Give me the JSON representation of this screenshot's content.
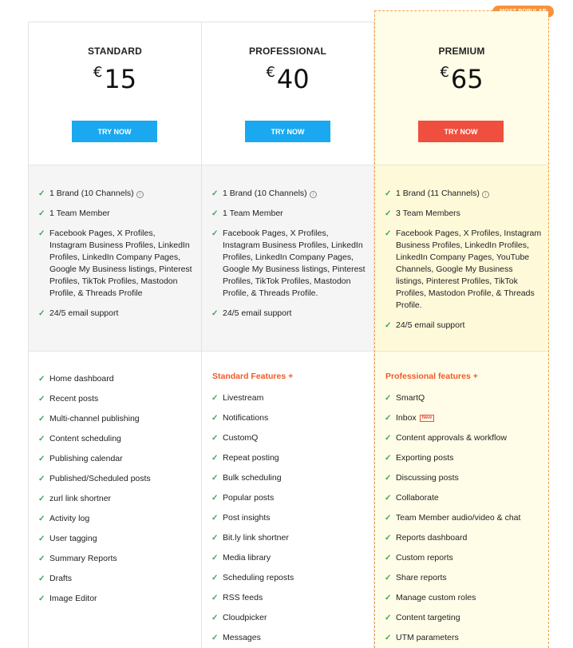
{
  "plans": [
    {
      "name": "STANDARD",
      "currency": "€",
      "price": "15",
      "cta": "TRY NOW",
      "summary": [
        {
          "text": "1 Brand (10 Channels)",
          "info": true
        },
        {
          "text": "1 Team Member"
        },
        {
          "text": "Facebook Pages, X Profiles, Instagram Business Profiles, LinkedIn Profiles, LinkedIn Company Pages, Google My Business listings, Pinterest Profiles, TikTok Profiles, Mastodon Profile, & Threads Profile"
        },
        {
          "text": "24/5 email support"
        }
      ],
      "features_heading": "",
      "features": [
        "Home dashboard",
        "Recent posts",
        "Multi-channel publishing",
        "Content scheduling",
        "Publishing calendar",
        "Published/Scheduled posts",
        "zurl link shortner",
        "Activity log",
        "User tagging",
        "Summary Reports",
        "Drafts",
        "Image Editor"
      ]
    },
    {
      "name": "PROFESSIONAL",
      "currency": "€",
      "price": "40",
      "cta": "TRY NOW",
      "summary": [
        {
          "text": "1 Brand (10 Channels)",
          "info": true
        },
        {
          "text": "1 Team Member"
        },
        {
          "text": "Facebook Pages, X Profiles, Instagram Business Profiles, LinkedIn Profiles, LinkedIn Company Pages, Google My Business listings, Pinterest Profiles, TikTok Profiles, Mastodon Profile, & Threads Profile."
        },
        {
          "text": "24/5 email support"
        }
      ],
      "features_heading": "Standard Features +",
      "features": [
        "Livestream",
        "Notifications",
        "CustomQ",
        "Repeat posting",
        "Bulk scheduling",
        "Popular posts",
        "Post insights",
        "Bit.ly link shortner",
        "Media library",
        "Scheduling reposts",
        "RSS feeds",
        "Cloudpicker",
        "Messages"
      ]
    },
    {
      "name": "PREMIUM",
      "currency": "€",
      "price": "65",
      "cta": "TRY NOW",
      "badge": "MOST POPULAR",
      "summary": [
        {
          "text": "1 Brand (11 Channels)",
          "info": true
        },
        {
          "text": "3 Team Members"
        },
        {
          "text": "Facebook Pages, X Profiles, Instagram Business Profiles, LinkedIn Profiles, LinkedIn Company Pages, YouTube Channels, Google My Business listings, Pinterest Profiles, TikTok Profiles, Mastodon Profile, & Threads Profile."
        },
        {
          "text": "24/5 email support"
        }
      ],
      "features_heading": "Professional features +",
      "features": [
        "SmartQ",
        "Inbox",
        "Content approvals & workflow",
        "Exporting posts",
        "Discussing posts",
        "Collaborate",
        "Team Member audio/video & chat",
        "Reports dashboard",
        "Custom reports",
        "Share reports",
        "Manage custom roles",
        "Content targeting",
        "UTM parameters"
      ],
      "new_tag": "New",
      "new_tag_on": "Inbox"
    }
  ],
  "check_icon": "check-icon",
  "info_icon": "info-icon",
  "colors": {
    "button_blue": "#1aa9f0",
    "button_red": "#f04e3e",
    "check_green": "#3aa55a",
    "section_orange": "#f05a28",
    "badge_orange": "#f7933a",
    "premium_bg": "#fffde7"
  }
}
